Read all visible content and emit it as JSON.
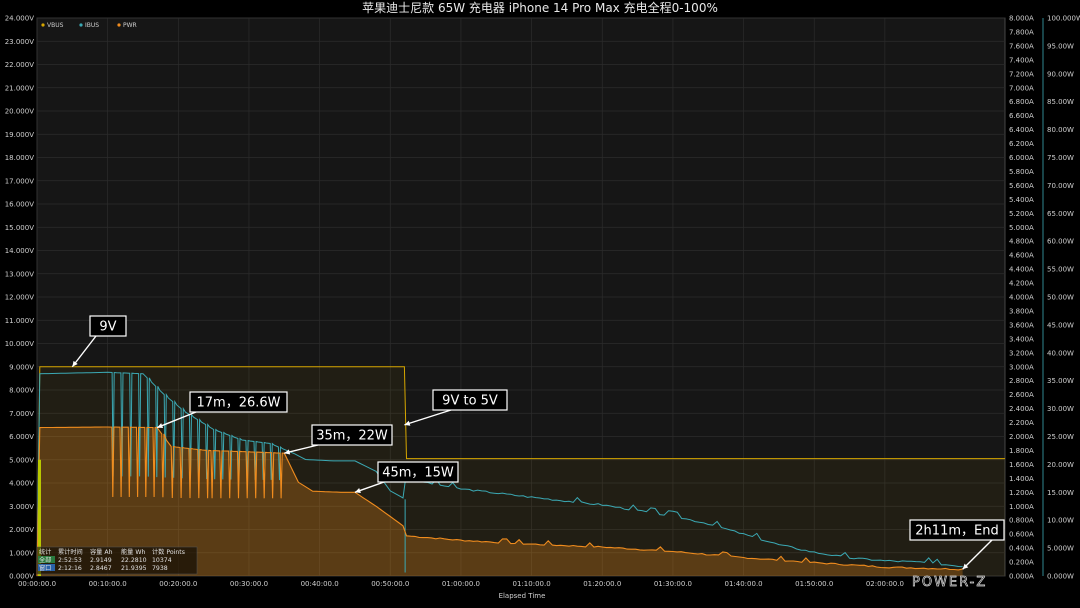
{
  "chart_data": {
    "type": "line",
    "title": "苹果迪士尼款 65W 充电器 iPhone 14 Pro Max 充电全程0-100%",
    "xlabel": "Elapsed Time",
    "x_ticks": [
      "00:00:00.0",
      "00:10:00.0",
      "00:20:00.0",
      "00:30:00.0",
      "00:40:00.0",
      "00:50:00.0",
      "01:00:00.0",
      "01:10:00.0",
      "01:20:00.0",
      "01:30:00.0",
      "01:40:00.0",
      "01:50:00.0",
      "02:00:00.0"
    ],
    "xlim_min": [
      0,
      137
    ],
    "y_left": {
      "ticks": [
        "0.000V",
        "1.000V",
        "2.000V",
        "3.000V",
        "4.000V",
        "5.000V",
        "6.000V",
        "7.000V",
        "8.000V",
        "9.000V",
        "10.000V",
        "11.000V",
        "12.000V",
        "13.000V",
        "14.000V",
        "15.000V",
        "16.000V",
        "17.000V",
        "18.000V",
        "19.000V",
        "20.000V",
        "21.000V",
        "22.000V",
        "23.000V",
        "24.000V"
      ],
      "range": [
        0,
        24
      ]
    },
    "y_right1": {
      "ticks": [
        "0.000A",
        "0.200A",
        "0.400A",
        "0.600A",
        "0.800A",
        "1.000A",
        "1.200A",
        "1.400A",
        "1.600A",
        "1.800A",
        "2.000A",
        "2.200A",
        "2.400A",
        "2.600A",
        "2.800A",
        "3.000A",
        "3.200A",
        "3.400A",
        "3.600A",
        "3.800A",
        "4.000A",
        "4.200A",
        "4.400A",
        "4.600A",
        "4.800A",
        "5.000A",
        "5.200A",
        "5.400A",
        "5.600A",
        "5.800A",
        "6.000A",
        "6.200A",
        "6.400A",
        "6.600A",
        "6.800A",
        "7.000A",
        "7.200A",
        "7.400A",
        "7.600A",
        "7.800A",
        "8.000A"
      ],
      "range": [
        0,
        8
      ]
    },
    "y_right2": {
      "ticks": [
        "0.000W",
        "5.000W",
        "10.00W",
        "15.00W",
        "20.00W",
        "25.00W",
        "30.00W",
        "35.00W",
        "40.00W",
        "45.00W",
        "50.00W",
        "55.00W",
        "60.00W",
        "65.00W",
        "70.00W",
        "75.00W",
        "80.00W",
        "85.00W",
        "90.00W",
        "95.00W",
        "100.000W"
      ],
      "range": [
        0,
        100
      ]
    },
    "legend": [
      "VBUS",
      "IBUS",
      "PWR"
    ],
    "legend_position": "top-left",
    "grid": true,
    "series": [
      {
        "name": "VBUS",
        "color": "#d6a600",
        "points": [
          [
            0,
            0
          ],
          [
            0.4,
            9.0
          ],
          [
            52,
            9.0
          ],
          [
            52.3,
            5.05
          ],
          [
            137,
            5.05
          ]
        ]
      },
      {
        "name": "IBUS",
        "color": "#3ba9b4",
        "points": [
          [
            0,
            0
          ],
          [
            0.4,
            2.9
          ],
          [
            10,
            2.92
          ],
          [
            15,
            2.9
          ],
          [
            18,
            2.6
          ],
          [
            21,
            2.35
          ],
          [
            25,
            2.1
          ],
          [
            29,
            1.95
          ],
          [
            33,
            1.9
          ],
          [
            36.5,
            1.75
          ],
          [
            38,
            1.67
          ],
          [
            42,
            1.65
          ],
          [
            45,
            1.65
          ],
          [
            48,
            1.5
          ],
          [
            50,
            1.22
          ],
          [
            51.8,
            1.12
          ],
          [
            52.2,
            1.42
          ],
          [
            53,
            1.38
          ],
          [
            60,
            1.25
          ],
          [
            70,
            1.13
          ],
          [
            80,
            1.02
          ],
          [
            85,
            0.94
          ],
          [
            90,
            0.86
          ],
          [
            95,
            0.75
          ],
          [
            100,
            0.6
          ],
          [
            105,
            0.45
          ],
          [
            110,
            0.34
          ],
          [
            115,
            0.26
          ],
          [
            120,
            0.22
          ],
          [
            125,
            0.2
          ],
          [
            131,
            0.14
          ]
        ]
      },
      {
        "name": "PWR",
        "color": "#f08c1e",
        "points": [
          [
            0,
            0
          ],
          [
            0.4,
            26.6
          ],
          [
            10,
            26.7
          ],
          [
            17,
            26.6
          ],
          [
            19,
            23.2
          ],
          [
            24,
            22.5
          ],
          [
            29,
            22.3
          ],
          [
            35,
            22.0
          ],
          [
            37,
            16.8
          ],
          [
            39,
            15.2
          ],
          [
            43,
            15.0
          ],
          [
            45,
            15.0
          ],
          [
            48,
            12.5
          ],
          [
            51.8,
            9.0
          ],
          [
            52.3,
            7.2
          ],
          [
            60,
            6.4
          ],
          [
            70,
            5.7
          ],
          [
            80,
            5.2
          ],
          [
            90,
            4.4
          ],
          [
            100,
            3.3
          ],
          [
            110,
            2.4
          ],
          [
            120,
            1.6
          ],
          [
            131,
            1.2
          ]
        ]
      }
    ],
    "oscillation": {
      "from": 10.5,
      "to": 35,
      "ibus_low": 1.35,
      "pwr_low": 13.5
    },
    "annotations": [
      {
        "text": "9V",
        "x": 5,
        "y_volt": 9.0
      },
      {
        "text": "17m，26.6W",
        "x": 17,
        "y_watt": 26.6
      },
      {
        "text": "35m，22W",
        "x": 35,
        "y_watt": 22.0
      },
      {
        "text": "9V to 5V",
        "x": 52,
        "y_volt": 6.5
      },
      {
        "text": "45m，15W",
        "x": 45,
        "y_watt": 15.0
      },
      {
        "text": "2h11m，End",
        "x": 131,
        "y_watt": 1.2
      }
    ]
  },
  "stats_table": {
    "headers": [
      "统计",
      "累计时间",
      "容量 Ah",
      "能量 Wh",
      "计数 Points"
    ],
    "rows": [
      [
        "全部",
        "2:52:53",
        "2.9149",
        "22.2810",
        "10374"
      ],
      [
        "窗口",
        "2:12:16",
        "2.8467",
        "21.9395",
        "7938"
      ]
    ]
  },
  "watermark": "POWER-Z"
}
